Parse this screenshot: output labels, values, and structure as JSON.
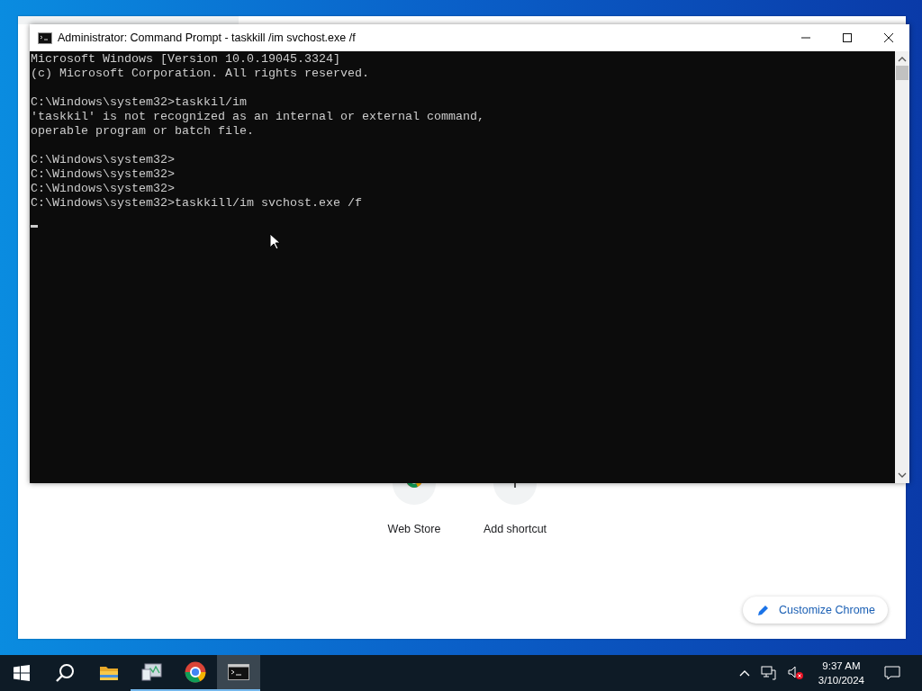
{
  "console_window": {
    "title": "Administrator: Command Prompt - taskkill /im svchost.exe /f",
    "blocks": [
      [
        "Microsoft Windows [Version 10.0.19045.3324]",
        "(c) Microsoft Corporation. All rights reserved."
      ],
      [
        "C:\\Windows\\system32>taskkil/im",
        "'taskkil' is not recognized as an internal or external command,",
        "operable program or batch file."
      ],
      [
        "C:\\Windows\\system32>",
        "C:\\Windows\\system32>",
        "C:\\Windows\\system32>",
        "C:\\Windows\\system32>taskkill/im svchost.exe /f"
      ]
    ]
  },
  "browser_window": {
    "shortcuts": [
      {
        "kind": "store",
        "label": "Web Store"
      },
      {
        "kind": "add",
        "label": "Add shortcut"
      }
    ],
    "customize_button": "Customize Chrome"
  },
  "taskbar": {
    "apps": [
      {
        "kind": "explorer",
        "running": false,
        "selected": false
      },
      {
        "kind": "monitor",
        "running": true,
        "selected": false
      },
      {
        "kind": "browser",
        "running": true,
        "selected": false
      },
      {
        "kind": "console",
        "running": true,
        "selected": true
      }
    ],
    "clock": {
      "time": "9:37 AM",
      "date": "3/10/2024"
    }
  }
}
